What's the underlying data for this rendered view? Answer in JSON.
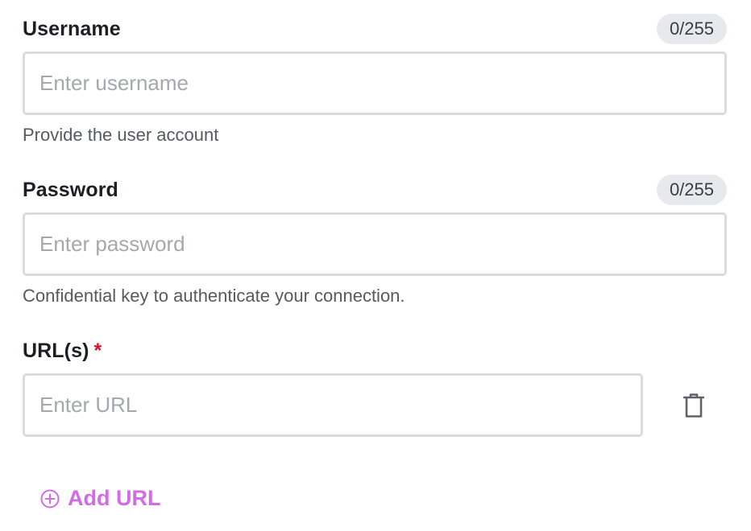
{
  "fields": {
    "username": {
      "label": "Username",
      "counter": "0/255",
      "placeholder": "Enter username",
      "value": "",
      "helper": "Provide the user account"
    },
    "password": {
      "label": "Password",
      "counter": "0/255",
      "placeholder": "Enter password",
      "value": "",
      "helper": "Confidential key to authenticate your connection."
    },
    "urls": {
      "label": "URL(s)",
      "required_marker": "*",
      "items": [
        {
          "placeholder": "Enter URL",
          "value": ""
        }
      ],
      "add_label": "Add URL"
    }
  },
  "icons": {
    "delete": "trash-icon",
    "add": "plus-circle-icon"
  },
  "colors": {
    "accent": "#d36ae6",
    "required": "#d8102a",
    "border": "#dadbdd",
    "counter_bg": "#e8e9ec"
  }
}
